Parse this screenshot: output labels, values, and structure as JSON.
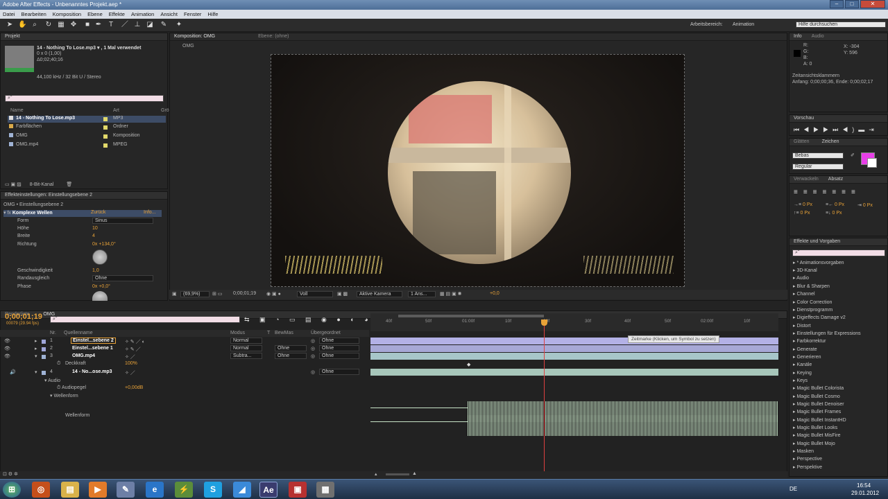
{
  "window": {
    "title": "Adobe After Effects - Unbenanntes Projekt.aep *",
    "controls": [
      "–",
      "□",
      "✕"
    ]
  },
  "menu": [
    "Datei",
    "Bearbeiten",
    "Komposition",
    "Ebene",
    "Effekte",
    "Animation",
    "Ansicht",
    "Fenster",
    "Hilfe"
  ],
  "toolbar": {
    "workspace_label": "Arbeitsbereich:",
    "workspace_value": "Animation",
    "help_placeholder": "Hilfe durchsuchen"
  },
  "project": {
    "tab": "Projekt",
    "selected_name": "14 - Nothing To Lose.mp3 ▾ , 1 Mal verwendet",
    "info1": "0 x 0 (1,00)",
    "info2": "Δ0;02;40;16",
    "info3": "44,100 kHz / 32 Bit U / Stereo",
    "col_name": "Name",
    "col_type": "Art",
    "col_extra": "Grö",
    "items": [
      {
        "name": "14 - Nothing To Lose.mp3",
        "type": "MP3"
      },
      {
        "name": "Farbflächen",
        "type": "Ordner"
      },
      {
        "name": "OMG",
        "type": "Komposition"
      },
      {
        "name": "OMG.mp4",
        "type": "MPEG"
      }
    ],
    "bit_depth": "8-Bit-Kanal"
  },
  "effects_controls": {
    "tab": "Effekteinstellungen: Einstellungsebene 2",
    "path": "OMG • Einstellungsebene 2",
    "effect_name": "Komplexe Wellen",
    "reset": "Zurück",
    "info": "Info...",
    "props": [
      {
        "name": "Form",
        "value": "Sinus"
      },
      {
        "name": "Höhe",
        "value": "10"
      },
      {
        "name": "Breite",
        "value": "4"
      },
      {
        "name": "Richtung",
        "value": "0x +134,0°"
      },
      {
        "name": "Geschwindigkeit",
        "value": "1,0"
      },
      {
        "name": "Randausgleich",
        "value": "Ohne"
      },
      {
        "name": "Phase",
        "value": "0x +0,0°"
      }
    ]
  },
  "composition": {
    "tab": "Komposition: OMG",
    "layer_tab": "Ebene: (ohne)",
    "sub_tab": "OMG",
    "zoom": "(69,9%)",
    "timecode": "0;00;01;19",
    "quality": "Voll",
    "camera": "Aktive Kamera",
    "views": "1 Ans...",
    "exposure": "+0,0"
  },
  "info_panel": {
    "tab": "Info",
    "audio_tab": "Audio",
    "r": "R:",
    "g": "G:",
    "b": "B:",
    "a": "A: 0",
    "x": "X: -304",
    "y": "Y: 596",
    "brackets_label": "Zeitansichtsklammern",
    "brackets_value": "Anfang: 0;00;00;36, Ende: 0;00;02;17"
  },
  "preview": {
    "tab": "Vorschau"
  },
  "character": {
    "tab1": "Glätten",
    "tab2": "Zeichen",
    "font": "Bebas",
    "style": "Regular",
    "accent": "#e83ee8"
  },
  "paragraph": {
    "tab1": "Verwackeln",
    "tab2": "Absatz",
    "v1": "0 Px",
    "v2": "0 Px",
    "v3": "0 Px",
    "v4": "0 Px",
    "v5": "0 Px"
  },
  "effects_presets": {
    "tab": "Effekte und Vorgaben",
    "items": [
      "* Animationsvorgaben",
      "3D-Kanal",
      "Audio",
      "Blur & Sharpen",
      "Channel",
      "Color Correction",
      "Dienstprogramm",
      "Digieffects Damage v2",
      "Distort",
      "Einstellungen für Expressions",
      "Farbkorrektur",
      "Generate",
      "Generieren",
      "Kanäle",
      "Keying",
      "Keys",
      "Magic Bullet Colorista",
      "Magic Bullet Cosmo",
      "Magic Bullet Denoiser",
      "Magic Bullet Frames",
      "Magic Bullet InstantHD",
      "Magic Bullet Looks",
      "Magic Bullet MisFire",
      "Magic Bullet Mojo",
      "Masken",
      "Perspective",
      "Perspektive"
    ]
  },
  "timeline": {
    "tab_render": "Renderliste",
    "tab_comp": "OMG",
    "timecode": "0;00;01;19",
    "frame_info": "00079 (29.94 fps)",
    "headers": {
      "nr": "Nr.",
      "source": "Quellenname",
      "mode": "Modus",
      "t": "T",
      "trkmat": "BewMas",
      "parent": "Übergeordnet"
    },
    "layers": [
      {
        "nr": "1",
        "name": "Einstel...sebene 2",
        "mode": "Normal",
        "trkmat": "",
        "parent": "Ohne"
      },
      {
        "nr": "2",
        "name": "Einstel...sebene 1",
        "mode": "Normal",
        "trkmat": "Ohne",
        "parent": "Ohne"
      },
      {
        "nr": "3",
        "name": "OMG.mp4",
        "mode": "Subtra...",
        "trkmat": "Ohne",
        "parent": "Ohne"
      },
      {
        "nr": "4",
        "name": "14 - No...ose.mp3",
        "mode": "",
        "trkmat": "",
        "parent": "Ohne"
      }
    ],
    "opacity_label": "Deckkraft",
    "opacity_value": "100%",
    "audio_label": "Audio",
    "level_label": "Audiopegel",
    "level_value": "+0,00dB",
    "waveform_label": "Wellenform",
    "waveform_label2": "Wellenform",
    "ruler": [
      "40f",
      "50f",
      "01:00f",
      "10f",
      "20f",
      "30f",
      "40f",
      "50f",
      "02:00f",
      "10f"
    ],
    "tooltip": "Zeitmarke (Klicken, um Symbol zu setzen)"
  },
  "taskbar": {
    "lang": "DE",
    "time": "16:54",
    "date": "29.01.2012"
  }
}
